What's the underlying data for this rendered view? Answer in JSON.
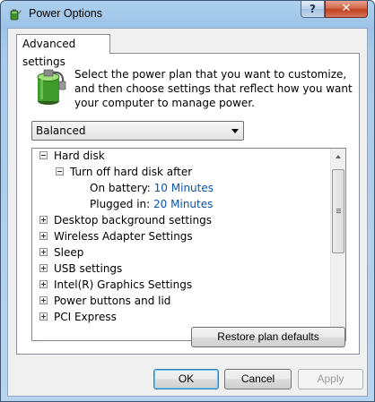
{
  "window": {
    "title": "Power Options",
    "help_label": "?",
    "close_label": "✕"
  },
  "tab": {
    "label": "Advanced settings"
  },
  "intro": {
    "text": "Select the power plan that you want to customize, and then choose settings that reflect how you want your computer to manage power."
  },
  "plan_select": {
    "value": "Balanced"
  },
  "tree": {
    "items": [
      {
        "label": "Hard disk",
        "state": "expanded"
      },
      {
        "label": "Turn off hard disk after",
        "state": "expanded"
      },
      {
        "label": "On battery:",
        "value": "10 Minutes"
      },
      {
        "label": "Plugged in:",
        "value": "20 Minutes"
      },
      {
        "label": "Desktop background settings",
        "state": "collapsed"
      },
      {
        "label": "Wireless Adapter Settings",
        "state": "collapsed"
      },
      {
        "label": "Sleep",
        "state": "collapsed"
      },
      {
        "label": "USB settings",
        "state": "collapsed"
      },
      {
        "label": "Intel(R) Graphics Settings",
        "state": "collapsed"
      },
      {
        "label": "Power buttons and lid",
        "state": "collapsed"
      },
      {
        "label": "PCI Express",
        "state": "collapsed"
      }
    ]
  },
  "buttons": {
    "restore": "Restore plan defaults",
    "ok": "OK",
    "cancel": "Cancel",
    "apply": "Apply"
  },
  "icons": {
    "title": "power-options-icon",
    "plan": "battery-plug-icon"
  }
}
